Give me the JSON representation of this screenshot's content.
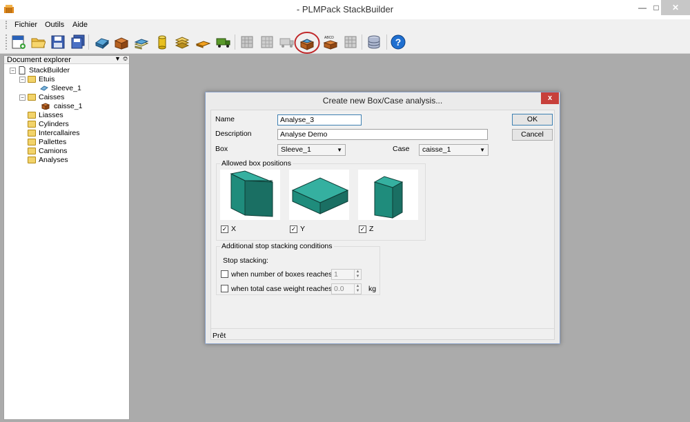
{
  "window": {
    "title": "- PLMPack StackBuilder"
  },
  "menu": [
    {
      "label": "Fichier"
    },
    {
      "label": "Outils"
    },
    {
      "label": "Aide"
    }
  ],
  "explorer": {
    "title": "Document explorer",
    "items": [
      {
        "label": "StackBuilder"
      },
      {
        "label": "Etuis"
      },
      {
        "label": "Sleeve_1"
      },
      {
        "label": "Caisses"
      },
      {
        "label": "caisse_1"
      },
      {
        "label": "Liasses"
      },
      {
        "label": "Cylinders"
      },
      {
        "label": "Intercallaires"
      },
      {
        "label": "Pallettes"
      },
      {
        "label": "Camions"
      },
      {
        "label": "Analyses"
      }
    ]
  },
  "dialog": {
    "title": "Create new Box/Case analysis...",
    "close": "x",
    "name_label": "Name",
    "name_value": "Analyse_3",
    "description_label": "Description",
    "description_value": "Analyse Demo",
    "box_label": "Box",
    "box_value": "Sleeve_1",
    "case_label": "Case",
    "case_value": "caisse_1",
    "ok": "OK",
    "cancel": "Cancel",
    "positions_title": "Allowed box positions",
    "positions": [
      {
        "label": "X",
        "checked": true
      },
      {
        "label": "Y",
        "checked": true
      },
      {
        "label": "Z",
        "checked": true
      }
    ],
    "stop_title": "Additional stop stacking conditions",
    "stop_stacking_label": "Stop stacking:",
    "num_boxes_label": "when number of boxes reaches",
    "num_boxes_value": "1",
    "weight_label": "when total case weight reaches",
    "weight_value": "0.0",
    "weight_unit": "kg",
    "status": "Prêt"
  },
  "colors": {
    "box_face_top": "#35b0a0",
    "box_face_front": "#1f8c7c",
    "box_face_side": "#1a6f63",
    "highlight_circle": "#c0282a"
  },
  "toolbar_icons": [
    "new-document-icon",
    "open-folder-icon",
    "save-icon",
    "save-all-icon",
    "new-box-icon",
    "new-case-icon",
    "new-bundle-icon",
    "new-cylinder-icon",
    "new-interlayer-icon",
    "new-pallet-icon",
    "new-truck-icon",
    "analysis-pallet-icon",
    "analysis-pallet-2-icon",
    "analysis-truck-icon",
    "box-case-analysis-icon",
    "case-optimization-icon",
    "case-grid-icon",
    "database-icon",
    "help-icon"
  ]
}
